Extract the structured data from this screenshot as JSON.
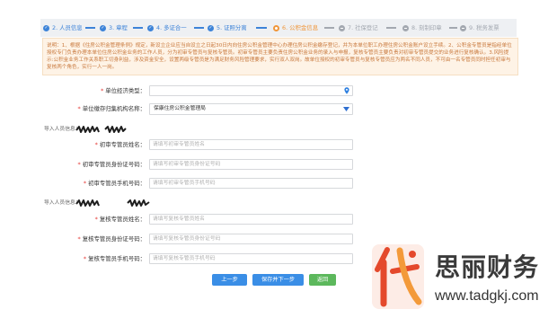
{
  "steps": [
    {
      "label": "2. 人员信息",
      "icon": "check-circle-icon",
      "color": "#3d83d8"
    },
    {
      "label": "3. 章程",
      "icon": "check-circle-icon",
      "color": "#3d83d8"
    },
    {
      "label": "4. 多证合一",
      "icon": "check-circle-icon",
      "color": "#3d83d8"
    },
    {
      "label": "5. 证照分离",
      "icon": "check-circle-icon",
      "color": "#3d83d8"
    },
    {
      "label": "6. 公积金信息",
      "icon": "current-step-icon",
      "color": "#f0963a"
    },
    {
      "label": "7. 社保登记",
      "icon": "pending-step-icon",
      "color": "#a3a8b0"
    },
    {
      "label": "8. 刻制印章",
      "icon": "pending-step-icon",
      "color": "#a3a8b0"
    },
    {
      "label": "9. 税务发票",
      "icon": "pending-step-icon",
      "color": "#a3a8b0"
    }
  ],
  "connector_colors": [
    "#3d83d8",
    "#3d83d8",
    "#3d83d8",
    "#3d83d8",
    "#a3a8b0",
    "#a3a8b0",
    "#a3a8b0"
  ],
  "notice": {
    "text": "说明：1、根据《住房公积金管理条例》规定，新设立企业应当自设立之日起30日内向住房公积金管理中心办理住房公积金缴存登记，并为本单位职工办理住房公积金账户设立手续。2、公积金专管员是指经单位授权专门负责办理本单位住房公积金业务的工作人员，分为初审专管员与复核专管员。初审专管员主要负责住房公积金业务的录入与申报，复核专管员主要负责对初审专管员提交的业务进行复核确认。3.风险提示:公积金业务工作关系职工切身利益，涉及资金安全，设置两级专管员是为满足财务风险管理要求，实行双人双岗。故单位授权的初审专管员与复核专管员应为两名不同人员，不可由一名专管员同时担任初审与复核两个角色，实行一人一岗。"
  },
  "form": {
    "required_mark": "*",
    "economic_type": {
      "label": "单位经济类型：",
      "value": "",
      "icon": "location-pin-icon"
    },
    "fund_agency": {
      "label": "单位缴存归集机构名称：",
      "value": "保康住房公积金管理局",
      "icon": "dropdown-triangle-icon"
    },
    "first_reviewer": {
      "import_label": "导入人员信息：",
      "name": {
        "label": "初审专管员姓名：",
        "placeholder": "请填写初审专管员姓名"
      },
      "id_number": {
        "label": "初审专管员身份证号码：",
        "placeholder": "请填写初审专管员身份证号码"
      },
      "phone": {
        "label": "初审专管员手机号码：",
        "placeholder": "请填写初审专管员手机号码"
      }
    },
    "second_reviewer": {
      "import_label": "导入人员信息：",
      "name": {
        "label": "复核专管员姓名：",
        "placeholder": "请填写复核专管员姓名"
      },
      "id_number": {
        "label": "复核专管员身份证号码：",
        "placeholder": "请填写复核专管员身份证号码"
      },
      "phone": {
        "label": "复核专管员手机号码：",
        "placeholder": "请填写复核专管员手机号码"
      }
    }
  },
  "buttons": {
    "prev": "上一步",
    "save_next": "保存并下一步",
    "back": "返回"
  },
  "colors": {
    "primary": "#3a8ee6",
    "success": "#5cb85c",
    "required": "#e53935",
    "notice_bg": "#fef3e6",
    "notice_text": "#c8783c",
    "logo_red": "#e4492c",
    "logo_orange": "#f39a3a"
  },
  "watermark": {
    "logo_char": "代",
    "brand": "思丽财务",
    "url": "www.tadgkj.com"
  }
}
